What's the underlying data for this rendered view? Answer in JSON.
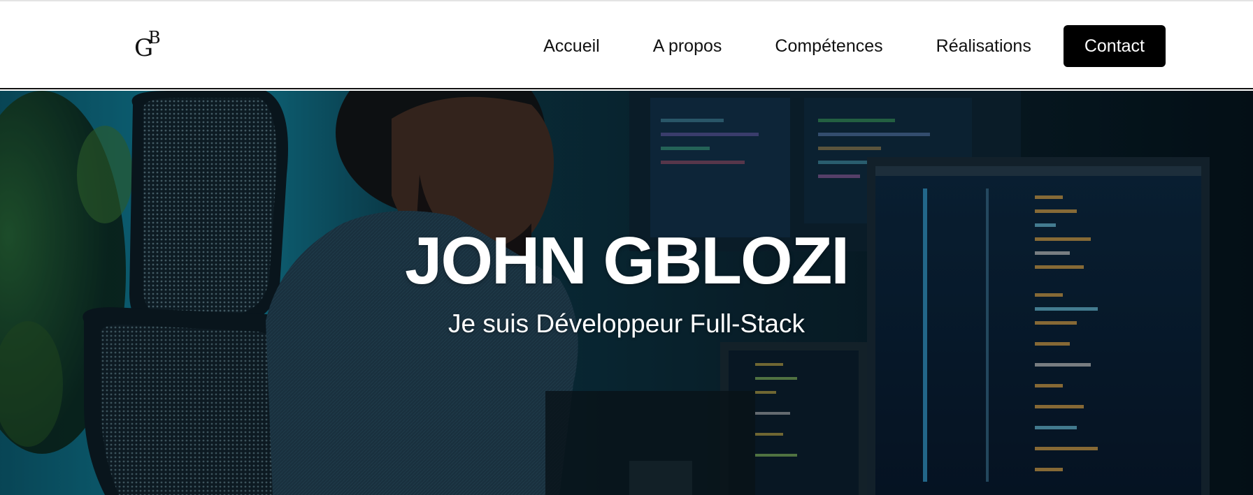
{
  "brand": {
    "logo_letter_1": "G",
    "logo_letter_2": "B"
  },
  "nav": {
    "items": [
      {
        "label": "Accueil"
      },
      {
        "label": "A propos"
      },
      {
        "label": "Compétences"
      },
      {
        "label": "Réalisations"
      }
    ],
    "contact_label": "Contact"
  },
  "hero": {
    "title": "JOHN GBLOZI",
    "subtitle": "Je suis Développeur Full-Stack",
    "background_image": "developer-at-desk-photo"
  },
  "colors": {
    "nav_background": "#ffffff",
    "nav_text": "#111111",
    "button_background": "#000000",
    "button_text": "#ffffff",
    "hero_text": "#ffffff"
  }
}
